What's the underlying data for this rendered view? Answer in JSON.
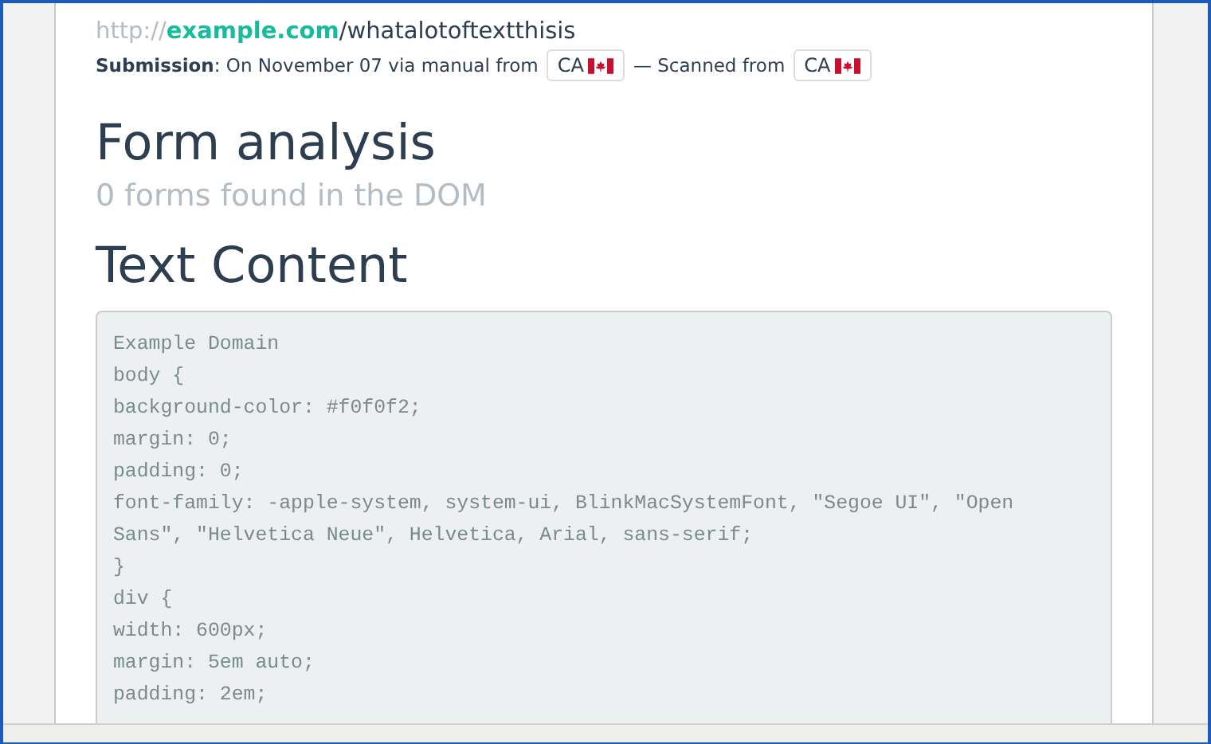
{
  "url": {
    "scheme": "http://",
    "domain": "example.com",
    "path": "/whatalotoftextthisis"
  },
  "submission": {
    "label": "Submission",
    "text": ": On November 07 via manual from",
    "from_country": "CA",
    "scanned_text": "— Scanned from",
    "scanned_country": "CA"
  },
  "form_analysis": {
    "heading": "Form analysis",
    "summary": "0 forms found in the DOM"
  },
  "text_content": {
    "heading": "Text Content",
    "lines": [
      "Example Domain",
      "body {",
      "background-color: #f0f0f2;",
      "margin: 0;",
      "padding: 0;",
      "font-family: -apple-system, system-ui, BlinkMacSystemFont, \"Segoe UI\", \"Open Sans\", \"Helvetica Neue\", Helvetica, Arial, sans-serif;",
      "}",
      "div {",
      "width: 600px;",
      "margin: 5em auto;",
      "padding: 2em;"
    ]
  }
}
